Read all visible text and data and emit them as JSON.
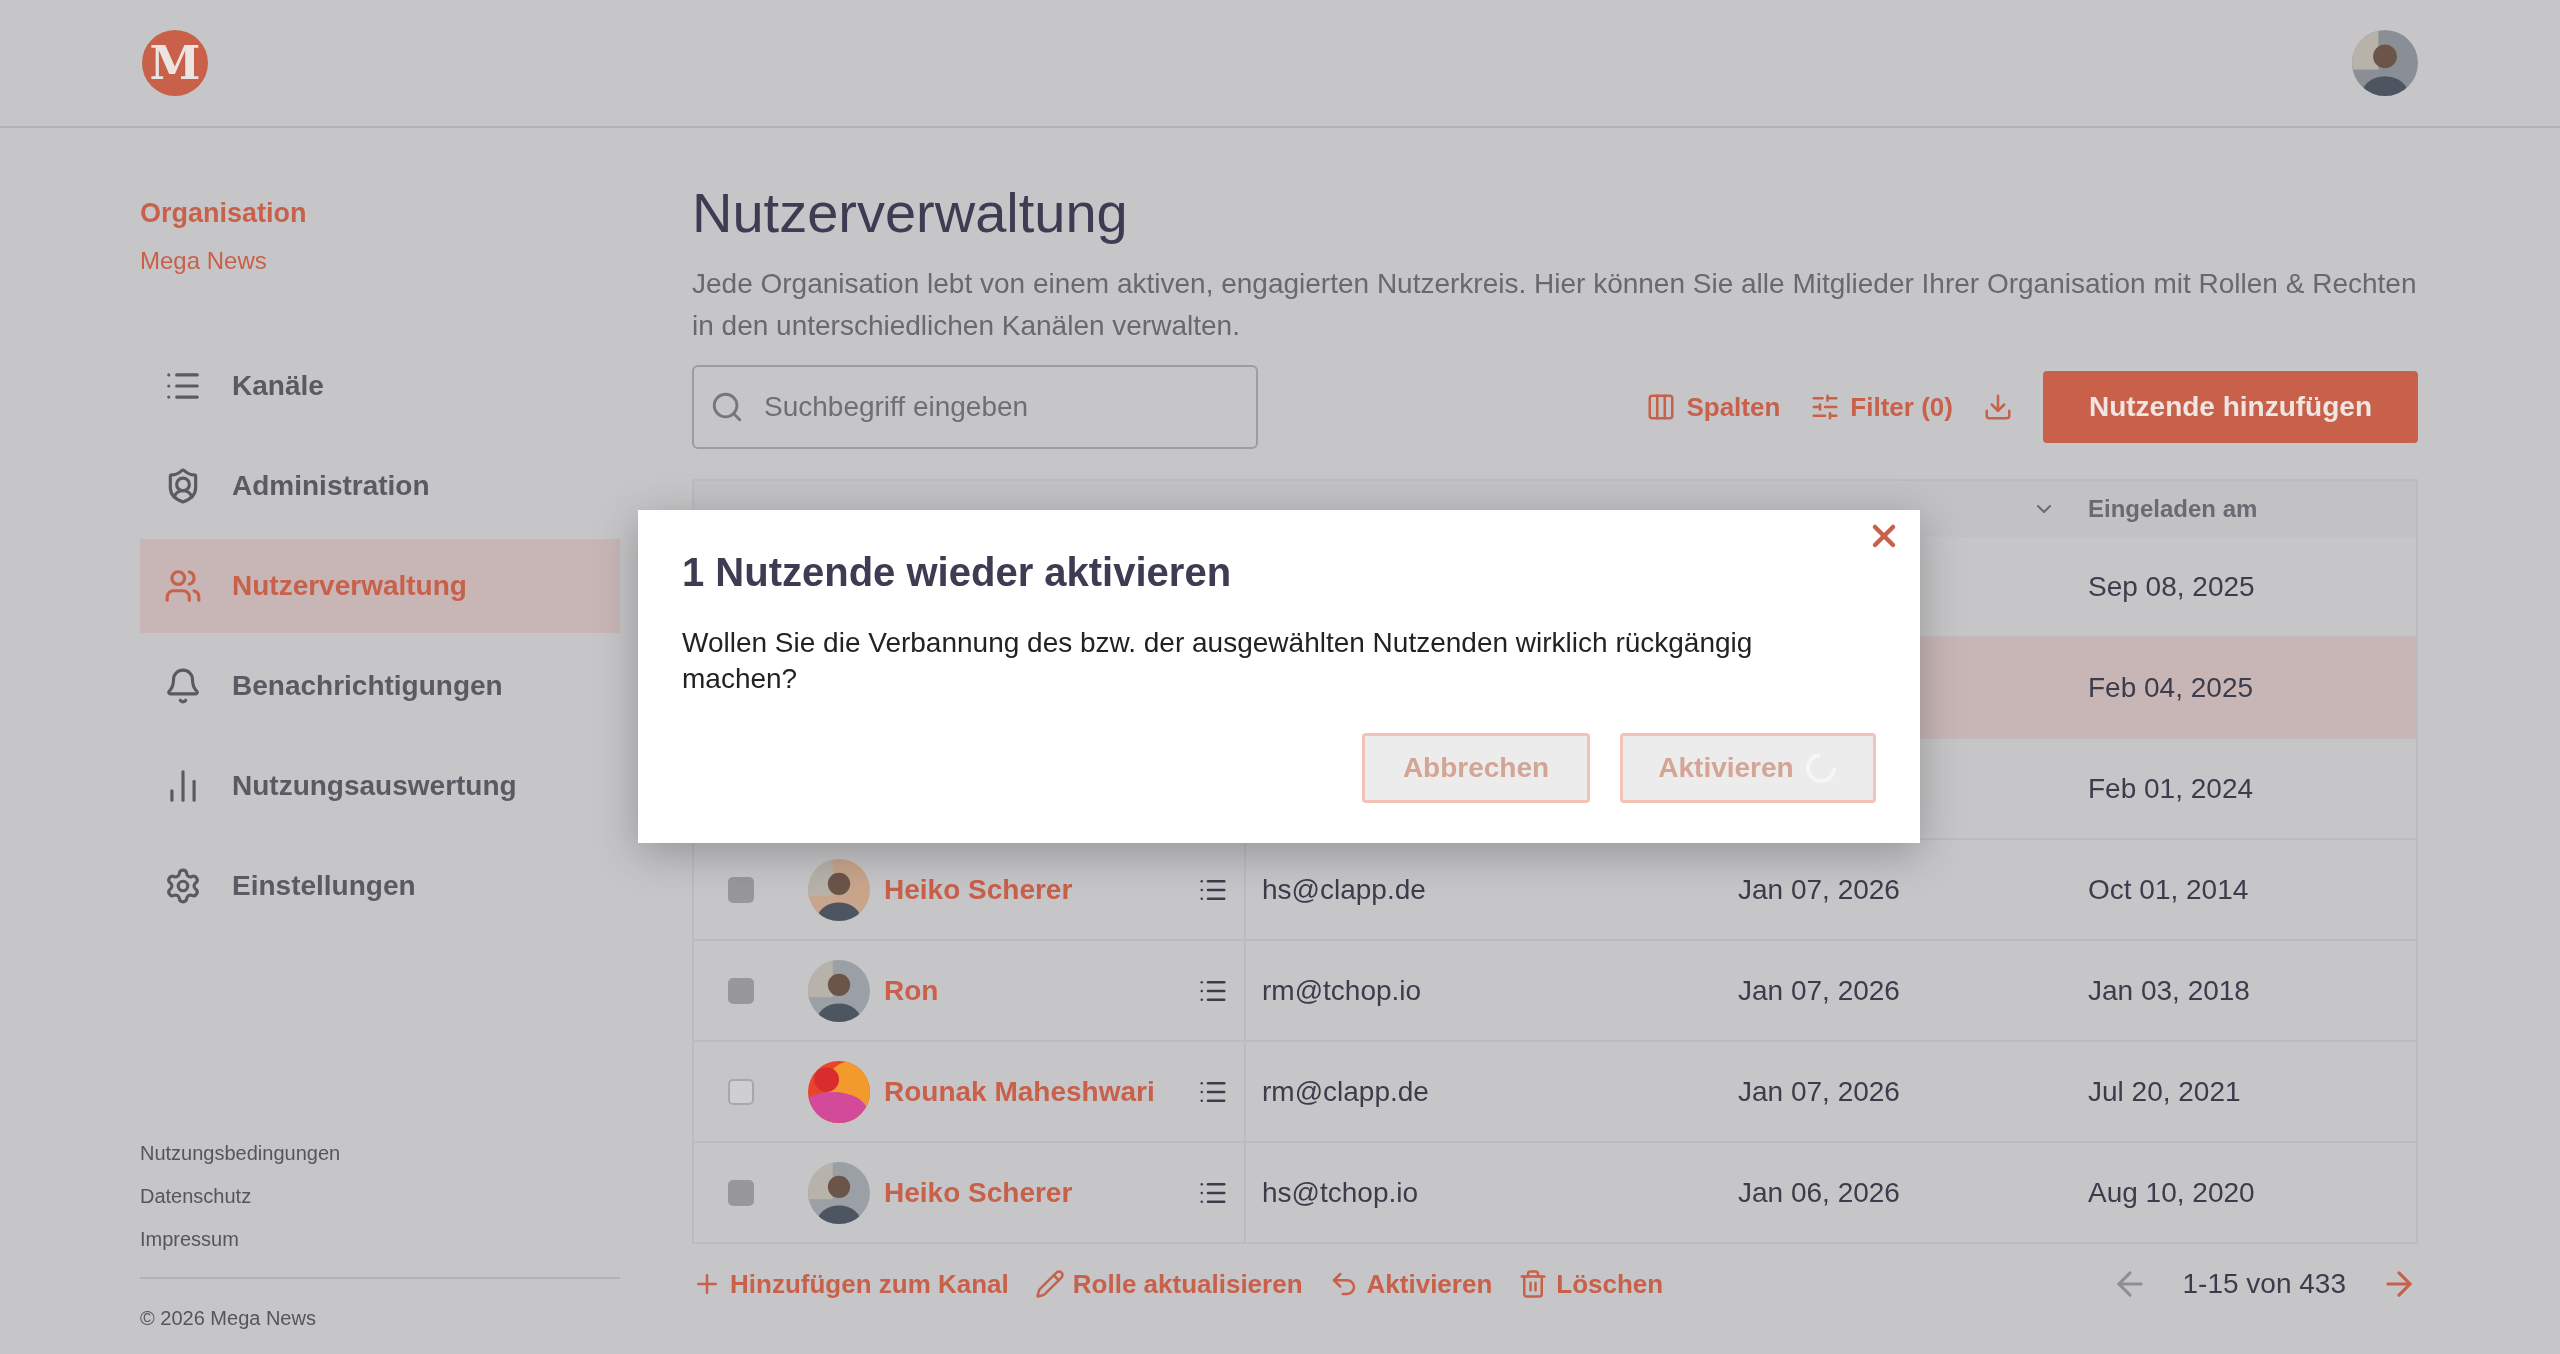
{
  "header": {
    "logo_letter": "M"
  },
  "sidebar": {
    "org_label": "Organisation",
    "org_name": "Mega News",
    "items": [
      {
        "label": "Kanäle",
        "selected": false
      },
      {
        "label": "Administration",
        "selected": false
      },
      {
        "label": "Nutzerverwaltung",
        "selected": true
      },
      {
        "label": "Benachrichtigungen",
        "selected": false
      },
      {
        "label": "Nutzungsauswertung",
        "selected": false
      },
      {
        "label": "Einstellungen",
        "selected": false
      }
    ],
    "footer_links": [
      "Nutzungsbedingungen",
      "Datenschutz",
      "Impressum"
    ],
    "copyright": "© 2026 Mega News"
  },
  "page": {
    "title": "Nutzerverwaltung",
    "description": "Jede Organisation lebt von einem aktiven, engagierten Nutzerkreis. Hier können Sie alle Mitglieder Ihrer Organisation mit Rollen & Rechten in den unterschiedlichen Kanälen verwalten."
  },
  "toolbar": {
    "search_placeholder": "Suchbegriff eingeben",
    "columns_label": "Spalten",
    "filter_label": "Filter (0)",
    "add_button": "Nutzende hinzufügen"
  },
  "table": {
    "columns": [
      {
        "sorted": false
      },
      {
        "sorted": false
      },
      {
        "sorted": true
      },
      {
        "label": "Eingeladen am",
        "sorted": false
      }
    ],
    "rows": [
      {
        "invited": "Sep 08, 2025",
        "selected": false
      },
      {
        "invited": "Feb 04, 2025",
        "selected": true
      },
      {
        "invited": "Feb 01, 2024",
        "selected": false
      },
      {
        "name": "Heiko Scherer",
        "email": "hs@clapp.de",
        "last_active": "Jan 07, 2026",
        "invited": "Oct 01, 2014",
        "selected": false,
        "disabled": true
      },
      {
        "name": "Ron",
        "email": "rm@tchop.io",
        "last_active": "Jan 07, 2026",
        "invited": "Jan 03, 2018",
        "selected": false,
        "disabled": true
      },
      {
        "name": "Rounak Maheshwari",
        "email": "rm@clapp.de",
        "last_active": "Jan 07, 2026",
        "invited": "Jul 20, 2021",
        "selected": false,
        "disabled": false
      },
      {
        "name": "Heiko Scherer",
        "email": "hs@tchop.io",
        "last_active": "Jan 06, 2026",
        "invited": "Aug 10, 2020",
        "selected": false,
        "disabled": true
      }
    ]
  },
  "bulk_actions": [
    "Hinzufügen zum Kanal",
    "Rolle aktualisieren",
    "Aktivieren",
    "Löschen"
  ],
  "pagination": {
    "range": "1-15 von 433",
    "prev_disabled": true
  },
  "dialog": {
    "title": "1 Nutzende wieder aktivieren",
    "message": "Wollen Sie die Verbannung des bzw. der ausgewählten Nutzenden wirklich rückgängig machen?",
    "buttons": [
      {
        "label": "Abbrechen",
        "disabled": true,
        "loading": false
      },
      {
        "label": "Aktivieren",
        "disabled": true,
        "loading": true
      }
    ]
  }
}
